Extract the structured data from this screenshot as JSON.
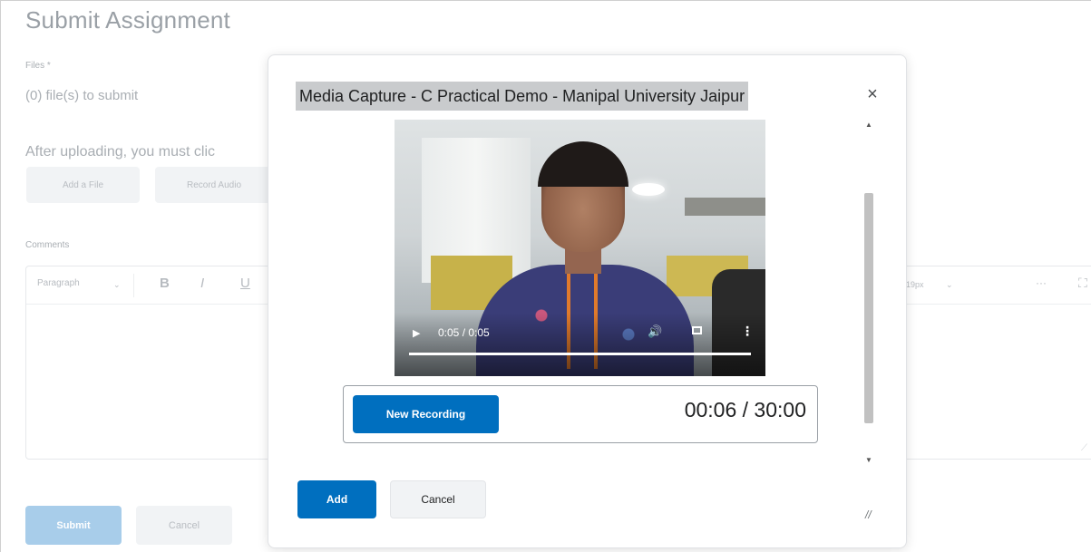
{
  "page": {
    "title": "Submit Assignment",
    "files_label": "Files *",
    "files_count": "(0) file(s) to submit",
    "after_upload": "After uploading, you must clic",
    "add_file_label": "Add a File",
    "record_audio_label": "Record Audio",
    "comments_label": "Comments",
    "editor": {
      "paragraph_label": "Paragraph",
      "font_size_label": "19px",
      "bold": "B",
      "italic": "I",
      "underline": "U",
      "more": "···"
    },
    "submit_label": "Submit",
    "cancel_label": "Cancel"
  },
  "modal": {
    "title": "Media Capture - C Practical Demo - Manipal University Jaipur",
    "close_symbol": "×",
    "video": {
      "time": "0:05 / 0:05",
      "progress_fraction": 1.0
    },
    "recorder": {
      "new_recording_label": "New Recording",
      "timer": "00:06 / 30:00"
    },
    "add_label": "Add",
    "cancel_label": "Cancel"
  },
  "colors": {
    "primary": "#006fbf",
    "title_highlight": "#c9cbcd",
    "muted_text": "#a9aeb3"
  },
  "icons": [
    "close-icon",
    "play-icon",
    "volume-icon",
    "fullscreen-icon",
    "more-vert-icon",
    "resize-grip-icon",
    "chevron-down-icon",
    "fullscreen-editor-icon"
  ]
}
